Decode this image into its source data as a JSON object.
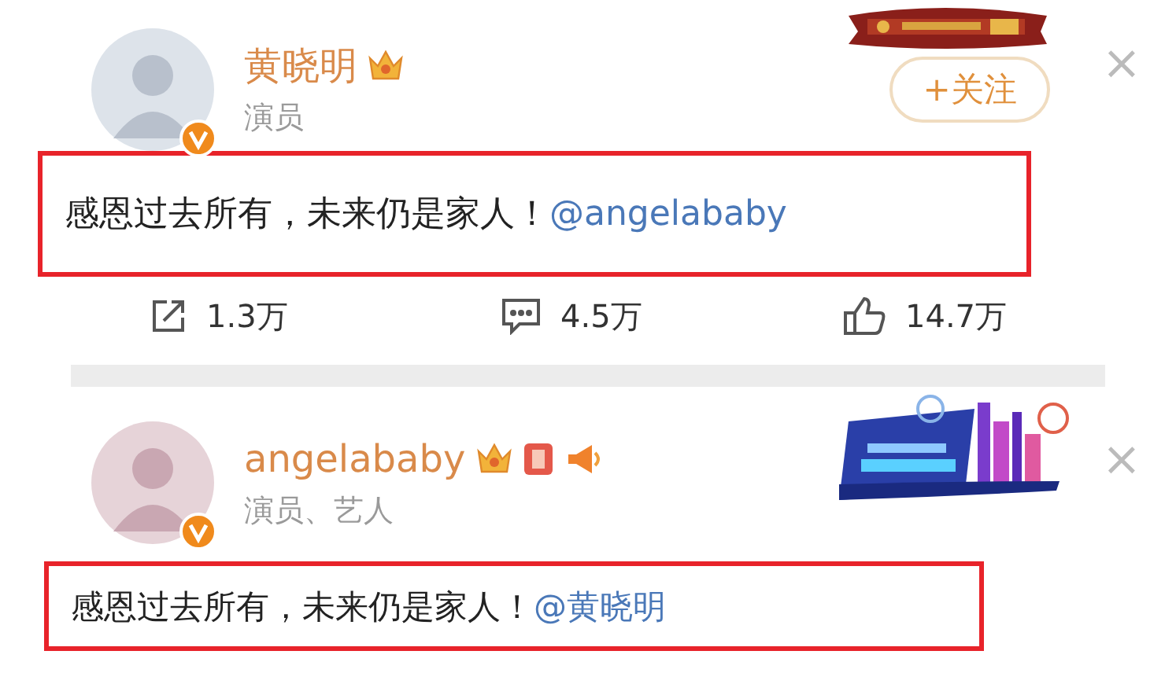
{
  "posts": [
    {
      "name": "黄晓明",
      "badges": [
        {
          "kind": "crown"
        }
      ],
      "verified": true,
      "subtitle": "演员",
      "banner": {
        "kind": "red"
      },
      "follow_button": "+关注",
      "close": "×",
      "highlighted": true,
      "text": "感恩过去所有，未来仍是家人！",
      "mention": "@angelababy",
      "actions": [
        {
          "kind": "share",
          "count": "1.3万"
        },
        {
          "kind": "comment",
          "count": "4.5万"
        },
        {
          "kind": "like",
          "count": "14.7万"
        }
      ]
    },
    {
      "name": "angelababy",
      "badges": [
        {
          "kind": "crown"
        },
        {
          "kind": "square-badge"
        },
        {
          "kind": "megaphone"
        }
      ],
      "verified": true,
      "subtitle": "演员、艺人",
      "banner": {
        "kind": "blue"
      },
      "close": "×",
      "highlighted": true,
      "text": "感恩过去所有，未来仍是家人！",
      "mention": "@黄晓明"
    }
  ]
}
